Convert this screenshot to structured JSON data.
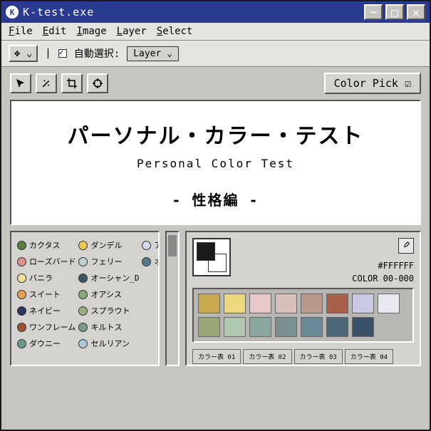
{
  "window": {
    "title": "K-test.exe"
  },
  "menubar": [
    "File",
    "Edit",
    "Image",
    "Layer",
    "Select"
  ],
  "toolbar": {
    "autoselect": "自動選択:",
    "layer": "Layer ⌄"
  },
  "colorpick": "Color Pick ☑",
  "hero": {
    "title": "パーソナル・カラー・テスト",
    "subtitle": "Personal Color Test",
    "section": "- 性格編 -"
  },
  "colorlist": [
    {
      "name": "カクタス",
      "c": "#5a7a3a"
    },
    {
      "name": "ローズバード",
      "c": "#d89090"
    },
    {
      "name": "バニラ",
      "c": "#f0e0a0"
    },
    {
      "name": "スイート",
      "c": "#e8a050"
    },
    {
      "name": "ネイビー",
      "c": "#2a3560"
    },
    {
      "name": "ワンフレーム",
      "c": "#a05030"
    },
    {
      "name": "ダウニー",
      "c": "#6a9a8a"
    },
    {
      "name": "ダンデル",
      "c": "#e8c850"
    },
    {
      "name": "フェリー",
      "c": "#c0d0d0"
    },
    {
      "name": "オーシャン_D",
      "c": "#3a5565"
    },
    {
      "name": "オアシス",
      "c": "#8aaa7a"
    },
    {
      "name": "スプラウト",
      "c": "#9ab080"
    },
    {
      "name": "キルトス",
      "c": "#7a9a90"
    },
    {
      "name": "セルリアン",
      "c": "#a8c8d8"
    },
    {
      "name": "アリス",
      "c": "#d0d8e8"
    },
    {
      "name": "オーシャン_B",
      "c": "#5a7a8a"
    }
  ],
  "picker": {
    "hex": "#FFFFFF",
    "code": "COLOR 00-000"
  },
  "palette": {
    "row1": [
      "#c9a84f",
      "#ecd87a",
      "#e8c8c8",
      "#d8c0b8",
      "#b89888",
      "#a86048",
      "#c8c8e0",
      "#e8e8f0"
    ],
    "row2": [
      "#9aa878",
      "#b0c8b0",
      "#8aa8a0",
      "#7a9090",
      "#6a8a98",
      "#4a6878",
      "#3a5068"
    ]
  },
  "tabs": [
    "カラー表 01",
    "カラー表 02",
    "カラー表 03",
    "カラー表 04"
  ]
}
